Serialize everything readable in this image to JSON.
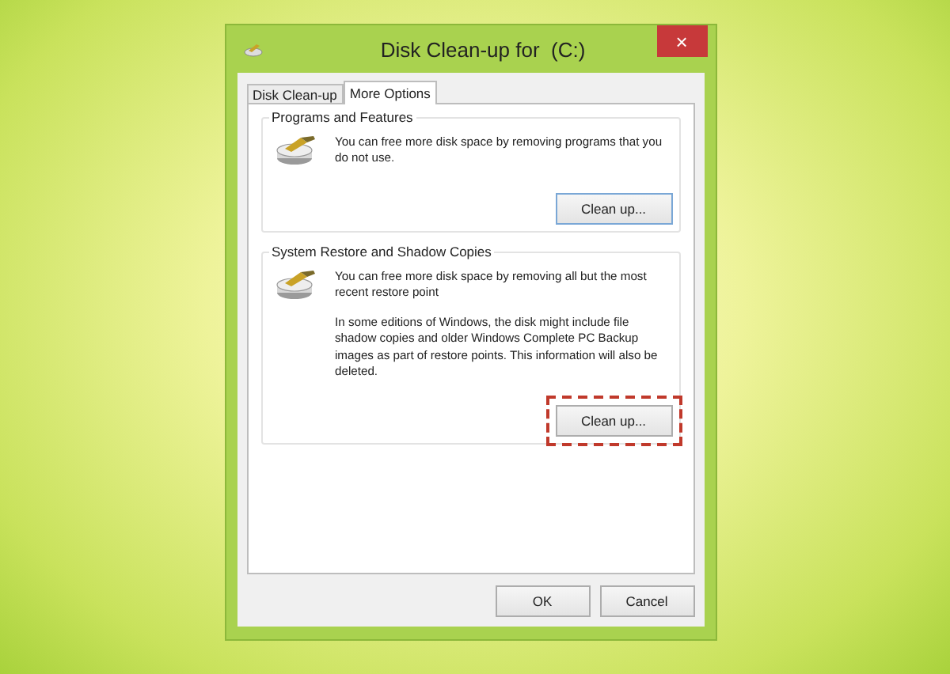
{
  "window": {
    "title": "Disk Clean-up for  (C:)",
    "close": "×"
  },
  "tabs": [
    {
      "label": "Disk Clean-up",
      "selected": false
    },
    {
      "label": "More Options",
      "selected": true
    }
  ],
  "groups": [
    {
      "title": "Programs and Features",
      "paragraphs": [
        "You can free more disk space by removing programs that you do not use."
      ],
      "button": {
        "label": "Clean up...",
        "highlighted": false,
        "focused": true
      }
    },
    {
      "title": "System Restore and Shadow Copies",
      "paragraphs": [
        "You can free more disk space by removing all but the most recent restore point",
        "In some editions of Windows, the disk might include file shadow copies and older Windows Complete PC Backup images as part of restore points. This information will also be deleted."
      ],
      "button": {
        "label": "Clean up...",
        "highlighted": true,
        "focused": false
      }
    }
  ],
  "buttons": [
    "OK",
    "Cancel"
  ]
}
